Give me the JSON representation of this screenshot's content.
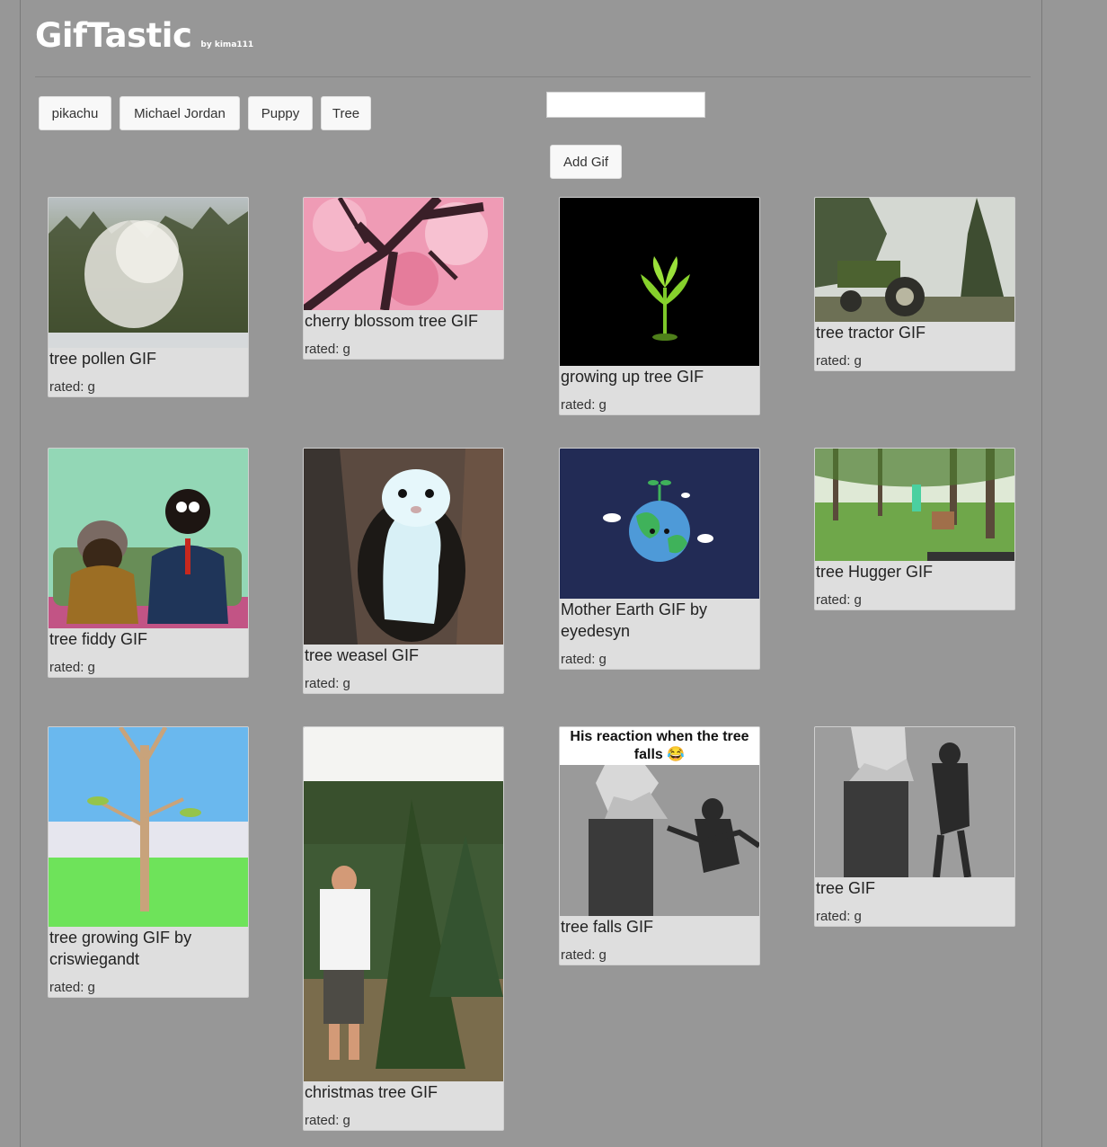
{
  "app": {
    "title": "GifTastic",
    "byline": "by kima111"
  },
  "topics": [
    "pikachu",
    "Michael Jordan",
    "Puppy",
    "Tree"
  ],
  "search": {
    "value": "",
    "placeholder": ""
  },
  "add_button": "Add Gif",
  "gifs": [
    {
      "caption": "tree pollen GIF",
      "rating": "rated: g"
    },
    {
      "caption": "cherry blossom tree GIF",
      "rating": "rated: g"
    },
    {
      "caption": "growing up tree GIF",
      "rating": "rated: g"
    },
    {
      "caption": "tree tractor GIF",
      "rating": "rated: g"
    },
    {
      "caption": "tree fiddy GIF",
      "rating": "rated: g"
    },
    {
      "caption": "tree weasel GIF",
      "rating": "rated: g"
    },
    {
      "caption": "Mother Earth GIF by eyedesyn",
      "rating": "rated: g"
    },
    {
      "caption": "tree Hugger GIF",
      "rating": "rated: g"
    },
    {
      "caption": "tree growing GIF by criswiegandt",
      "rating": "rated: g"
    },
    {
      "caption": "christmas tree GIF",
      "rating": "rated: g"
    },
    {
      "caption": "tree falls GIF",
      "rating": "rated: g",
      "image_text": "His reaction when the tree falls 😂"
    },
    {
      "caption": "tree GIF",
      "rating": "rated: g"
    }
  ]
}
